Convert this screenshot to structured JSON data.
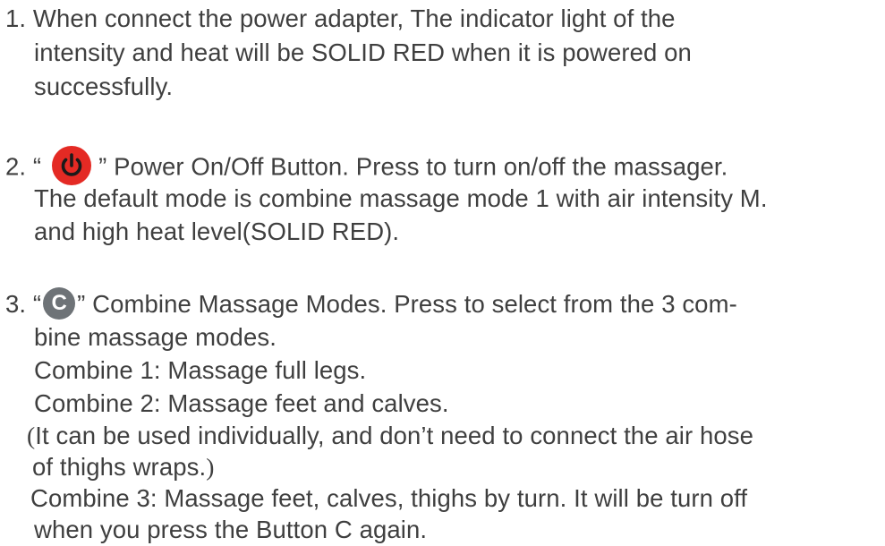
{
  "doc": {
    "item1": {
      "number": "1.",
      "line1": "When connect the power adapter, The indicator light of the",
      "line2": "intensity and heat will be SOLID RED when it is powered on",
      "line3": "successfully."
    },
    "item2": {
      "number": "2.",
      "open_quote": "“",
      "close_and_text": "” Power On/Off Button. Press to turn on/off the massager.",
      "line2": "The default mode is combine massage mode 1 with air intensity M.",
      "line3_prefix": "and high heat level",
      "line3_paren": "(SOLID RED).",
      "icon": "power-icon"
    },
    "item3": {
      "number": "3.",
      "open_quote": "“",
      "icon_letter": "C",
      "close_and_text": "” Combine Massage Modes. Press to select from the 3 com-",
      "line2": "bine massage modes.",
      "combine1": "Combine 1: Massage full legs.",
      "combine2": "Combine 2: Massage feet and calves.",
      "note_open": "(",
      "note_text": "It can be used individually, and don’t need to connect the air hose",
      "note_line2": "of thighs wraps.",
      "note_close": ")",
      "combine3_line1": "Combine 3: Massage feet, calves, thighs by turn. It will be turn off",
      "combine3_line2": "when you press the Button C again."
    }
  },
  "colors": {
    "text": "#3f3f3f",
    "power_icon": "#e42a24",
    "c_icon": "#6e7377"
  }
}
